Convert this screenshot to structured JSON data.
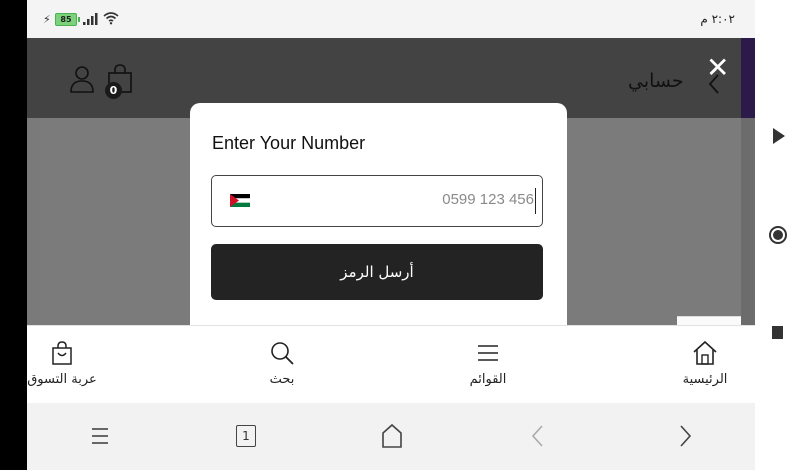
{
  "status_bar": {
    "time": "٢:٠٢ م",
    "battery_level": "85",
    "icons": [
      "charging-bolt-icon",
      "battery-icon",
      "signal-icon",
      "wifi-icon"
    ]
  },
  "header": {
    "account_label": "حسابي",
    "cart_count": "0",
    "close_icon": "close-icon",
    "icons": [
      "user-icon",
      "shopping-bag-icon",
      "chevron-left-icon"
    ]
  },
  "modal": {
    "title": "Enter Your Number",
    "phone_placeholder": "0599 123 456",
    "country_flag": "jordan-flag-icon",
    "send_button_label": "أرسل الرمز"
  },
  "bottom_nav": {
    "items": [
      {
        "label": "عربة التسوق",
        "icon": "shopping-bag-icon"
      },
      {
        "label": "بحث",
        "icon": "search-icon"
      },
      {
        "label": "القوائم",
        "icon": "menu-icon"
      },
      {
        "label": "الرئيسية",
        "icon": "home-icon"
      }
    ]
  },
  "system_nav": {
    "tab_count": "1",
    "icons": [
      "menu-icon",
      "tabs-icon",
      "home-icon",
      "back-icon",
      "forward-icon"
    ]
  },
  "side_controls": {
    "icons": [
      "play-icon",
      "record-icon",
      "stop-icon"
    ]
  },
  "colors": {
    "header_bg": "#434343",
    "dim_bg": "#7a7a7a",
    "button_bg": "#232323",
    "accent_purple": "#2c1a4a"
  }
}
